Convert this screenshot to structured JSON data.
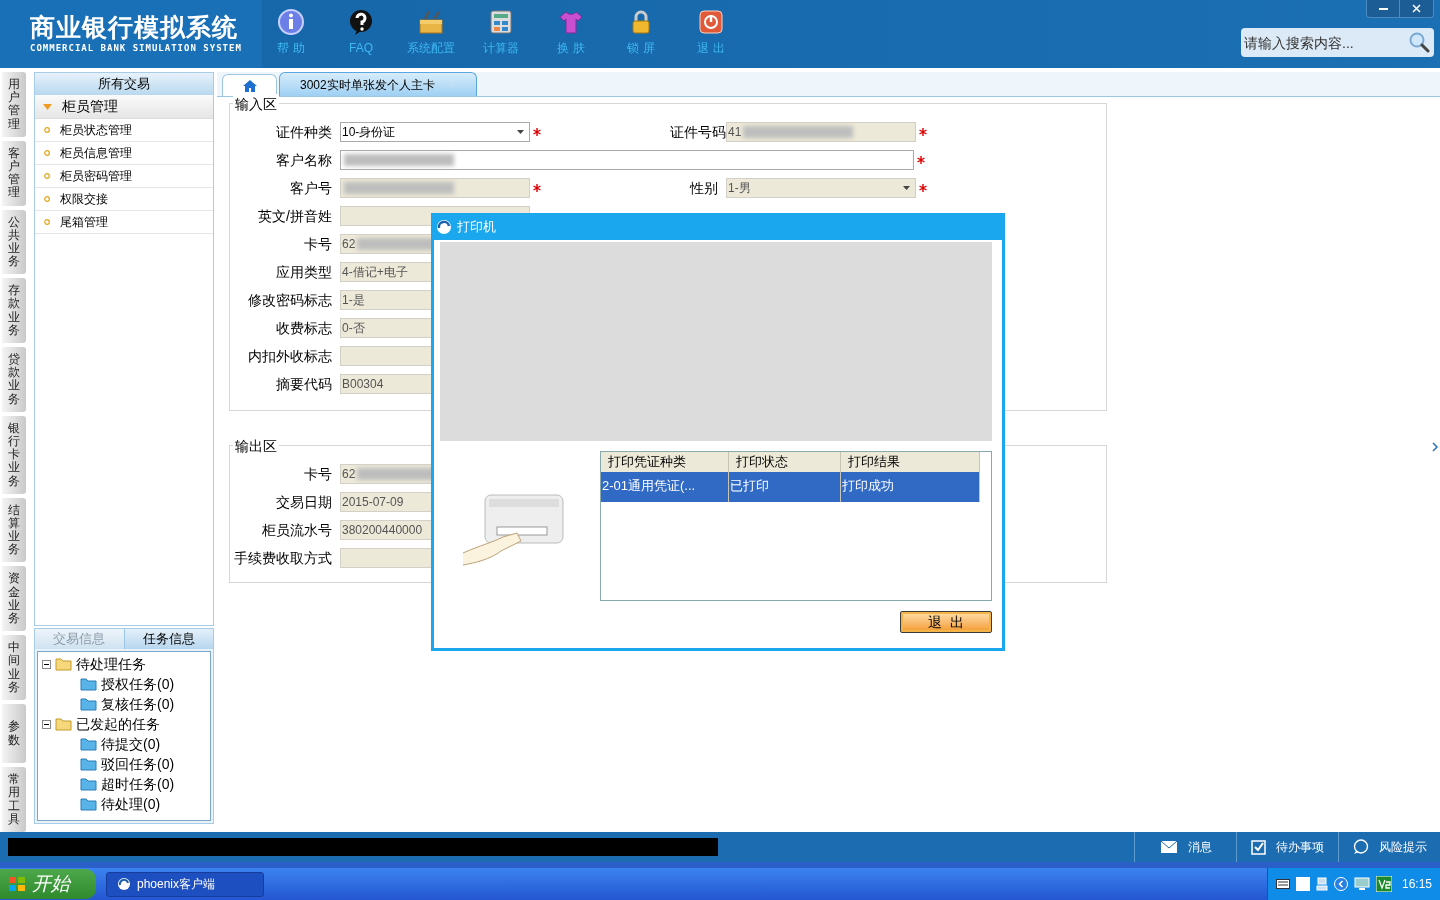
{
  "header": {
    "title": "商业银行模拟系统",
    "subtitle": "COMMERCIAL BANK SIMULATION SYSTEM",
    "search_placeholder": "请输入搜索内容...",
    "toolbar": [
      {
        "kind": "info",
        "label": "帮 助"
      },
      {
        "kind": "faq",
        "label": "FAQ"
      },
      {
        "kind": "config",
        "label": "系统配置"
      },
      {
        "kind": "calculator",
        "label": "计算器"
      },
      {
        "kind": "skin",
        "label": "换 肤"
      },
      {
        "kind": "lock",
        "label": "锁 屏"
      },
      {
        "kind": "exit",
        "label": "退 出"
      }
    ]
  },
  "left_rail": [
    "用户管理",
    "客户管理",
    "公共业务",
    "存款业务",
    "贷款业务",
    "银行卡业务",
    "结算业务",
    "资金业务",
    "中间业务",
    "参数",
    "常用工具"
  ],
  "nav": {
    "header": "所有交易",
    "group": {
      "label": "柜员管理",
      "expanded": true
    },
    "items": [
      "柜员状态管理",
      "柜员信息管理",
      "柜员密码管理",
      "权限交接",
      "尾箱管理"
    ]
  },
  "info_tabs": [
    {
      "label": "交易信息",
      "selected": false
    },
    {
      "label": "任务信息",
      "selected": true
    }
  ],
  "task_tree": [
    {
      "label": "待处理任务",
      "expanded": true,
      "children": [
        {
          "label": "授权任务(0)"
        },
        {
          "label": "复核任务(0)"
        }
      ]
    },
    {
      "label": "已发起的任务",
      "expanded": true,
      "children": [
        {
          "label": "待提交(0)"
        },
        {
          "label": "驳回任务(0)"
        },
        {
          "label": "超时任务(0)"
        },
        {
          "label": "待处理(0)"
        }
      ]
    }
  ],
  "tabs": [
    {
      "kind": "home",
      "selected": false
    },
    {
      "kind": "page",
      "label": "3002实时单张发个人主卡",
      "selected": false
    }
  ],
  "input_section": {
    "title": "输入区",
    "rows": [
      [
        {
          "label": "证件种类",
          "value": "10-身份证",
          "kind": "select",
          "readonly": false,
          "required": true,
          "blurred": false
        },
        {
          "label": "证件号码",
          "value": "41",
          "kind": "text",
          "readonly": true,
          "required": true,
          "blurred": true
        }
      ],
      [
        {
          "label": "客户名称",
          "kind": "wide",
          "readonly": false,
          "required": true,
          "blurred": true
        }
      ],
      [
        {
          "label": "客户号",
          "kind": "text",
          "readonly": true,
          "required": true,
          "blurred": true
        },
        {
          "label": "性别",
          "value": "1-男",
          "kind": "select",
          "readonly": true,
          "required": true,
          "blurred": false
        }
      ],
      [
        {
          "label": "英文/拼音姓",
          "kind": "text",
          "readonly": true,
          "blurred": false
        }
      ],
      [
        {
          "label": "卡号",
          "value": "62",
          "kind": "text",
          "readonly": true,
          "blurred": true
        }
      ],
      [
        {
          "label": "应用类型",
          "value": "4-借记+电子",
          "kind": "text",
          "readonly": true,
          "blurred": false
        }
      ],
      [
        {
          "label": "修改密码标志",
          "value": "1-是",
          "kind": "text",
          "readonly": true,
          "blurred": false
        }
      ],
      [
        {
          "label": "收费标志",
          "value": "0-否",
          "kind": "text",
          "readonly": true,
          "blurred": false
        }
      ],
      [
        {
          "label": "内扣外收标志",
          "kind": "text",
          "readonly": true,
          "blurred": false
        }
      ],
      [
        {
          "label": "摘要代码",
          "value": "B00304",
          "kind": "text",
          "readonly": true,
          "blurred": false
        }
      ]
    ]
  },
  "output_section": {
    "title": "输出区",
    "rows": [
      [
        {
          "label": "卡号",
          "value": "62",
          "kind": "text",
          "readonly": true,
          "blurred": true
        }
      ],
      [
        {
          "label": "交易日期",
          "value": "2015-07-09",
          "kind": "text",
          "readonly": true,
          "blurred": false
        }
      ],
      [
        {
          "label": "柜员流水号",
          "value": "380200440000",
          "kind": "text",
          "readonly": true,
          "blurred": false
        }
      ],
      [
        {
          "label": "手续费收取方式",
          "kind": "text",
          "readonly": true,
          "blurred": false
        }
      ]
    ]
  },
  "dialog": {
    "title": "打印机",
    "table": {
      "columns": [
        "打印凭证种类",
        "打印状态",
        "打印结果"
      ],
      "rows": [
        {
          "cells": [
            "2-01通用凭证(...",
            "已打印",
            "打印成功"
          ],
          "selected": true
        }
      ]
    },
    "button": "退  出"
  },
  "status_bar": [
    {
      "kind": "message",
      "label": "消息"
    },
    {
      "kind": "todo",
      "label": "待办事项"
    },
    {
      "kind": "risk",
      "label": "风险提示"
    }
  ],
  "taskbar": {
    "start": "开始",
    "apps": [
      "phoenix客户端"
    ],
    "clock": "16:15"
  }
}
